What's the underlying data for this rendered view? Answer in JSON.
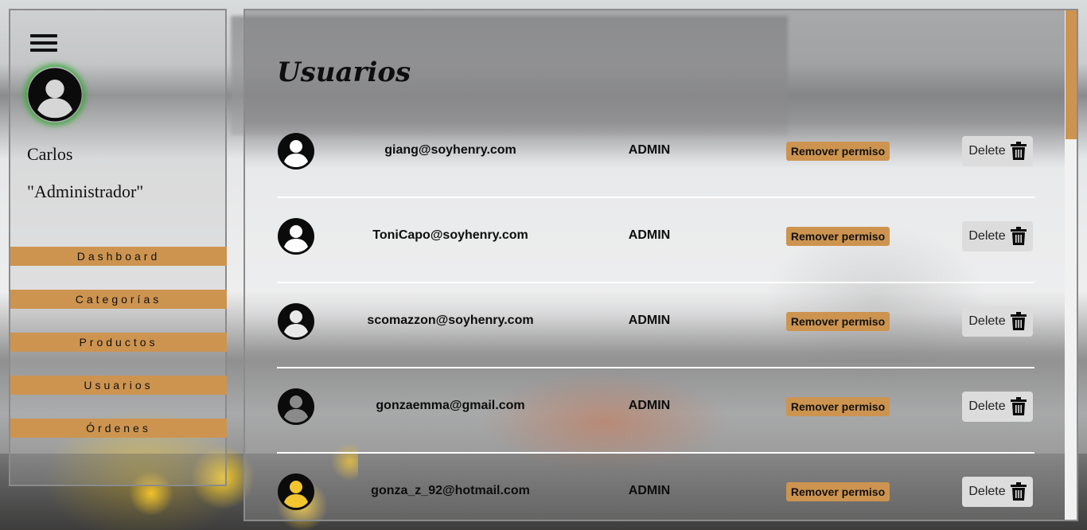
{
  "sidebar": {
    "menu_icon": "hamburger-menu-icon",
    "avatar_icon": "user-avatar-icon",
    "user_name": "Carlos",
    "user_role": "\"Administrador\"",
    "nav": [
      {
        "label": "Dashboard"
      },
      {
        "label": "Categorías"
      },
      {
        "label": "Productos"
      },
      {
        "label": "Usuarios"
      },
      {
        "label": "Órdenes"
      }
    ]
  },
  "main": {
    "title": "Usuarios",
    "users": [
      {
        "email": "giang@soyhenry.com",
        "role": "ADMIN",
        "action": "Remover permiso",
        "delete": "Delete"
      },
      {
        "email": "ToniCapo@soyhenry.com",
        "role": "ADMIN",
        "action": "Remover permiso",
        "delete": "Delete"
      },
      {
        "email": "scomazzon@soyhenry.com",
        "role": "ADMIN",
        "action": "Remover permiso",
        "delete": "Delete"
      },
      {
        "email": "gonzaemma@gmail.com",
        "role": "ADMIN",
        "action": "Remover permiso",
        "delete": "Delete"
      },
      {
        "email": "gonza_z_92@hotmail.com",
        "role": "ADMIN",
        "action": "Remover permiso",
        "delete": "Delete"
      }
    ]
  },
  "colors": {
    "accent": "#cd9450",
    "avatar_glow": "#3aa83a",
    "delete_bg": "#dcdcdc"
  }
}
